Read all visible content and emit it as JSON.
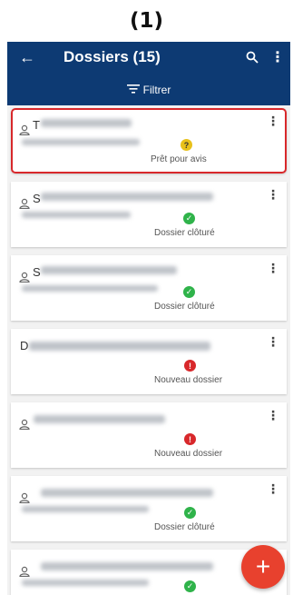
{
  "caption": "(1)",
  "appbar": {
    "back_icon": "←",
    "title": "Dossiers (15)",
    "search_icon": "search-icon",
    "menu_icon": "⋮",
    "filter_label": "Filtrer"
  },
  "cards": [
    {
      "initial": "T",
      "status": "Prêt pour avis",
      "status_icon": "?",
      "status_color": "#e8c11b",
      "selected": true
    },
    {
      "initial": "S",
      "status": "Dossier clôturé",
      "status_icon": "✓",
      "status_color": "#2fb34a",
      "selected": false
    },
    {
      "initial": "S",
      "status": "Dossier clôturé",
      "status_icon": "✓",
      "status_color": "#2fb34a",
      "selected": false
    },
    {
      "initial": "D",
      "status": "Nouveau dossier",
      "status_icon": "!",
      "status_color": "#d8282b",
      "selected": false
    },
    {
      "initial": "",
      "status": "Nouveau dossier",
      "status_icon": "!",
      "status_color": "#d8282b",
      "selected": false
    },
    {
      "initial": "",
      "status": "Dossier clôturé",
      "status_icon": "✓",
      "status_color": "#2fb34a",
      "selected": false
    },
    {
      "initial": "",
      "status": "",
      "status_icon": "✓",
      "status_color": "#2fb34a",
      "selected": false
    }
  ],
  "fab": {
    "label": "+"
  }
}
